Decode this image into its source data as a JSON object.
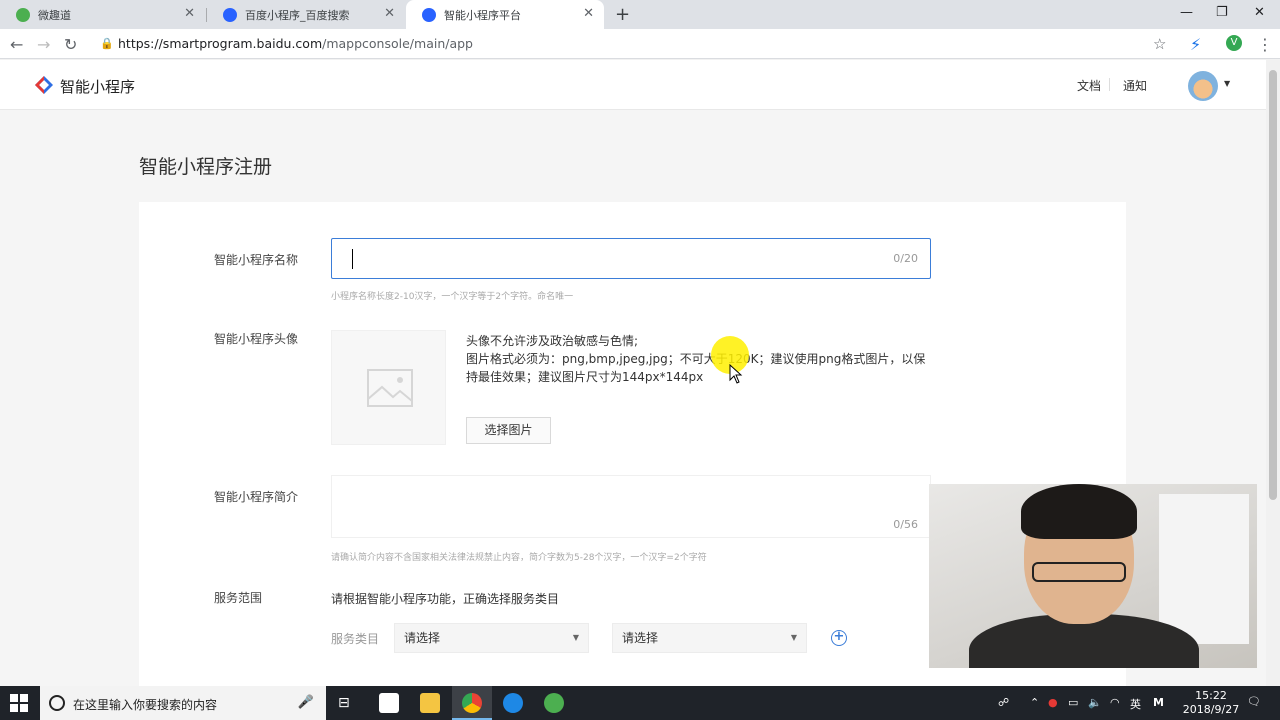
{
  "browser": {
    "tabs": [
      {
        "title": "微趣道",
        "favicon_color": "#4caf50"
      },
      {
        "title": "百度小程序_百度搜索",
        "favicon_color": "#2962ff"
      },
      {
        "title": "智能小程序平台",
        "favicon_color": "#2962ff"
      }
    ],
    "url_host": "https://smartprogram.baidu.com",
    "url_path": "/mappconsole/main/app"
  },
  "header": {
    "logo_text": "智能小程序",
    "nav": {
      "docs": "文档",
      "notice": "通知"
    }
  },
  "form": {
    "title": "智能小程序注册",
    "name": {
      "label": "智能小程序名称",
      "counter": "0/20",
      "hint": "小程序名称长度2-10汉字，一个汉字等于2个字符。命名唯一"
    },
    "avatar": {
      "label": "智能小程序头像",
      "desc_line1": "头像不允许涉及政治敏感与色情;",
      "desc_line2": "图片格式必须为：png,bmp,jpeg,jpg；不可大于120K；建议使用png格式图片，以保持最佳效果；建议图片尺寸为144px*144px",
      "button": "选择图片"
    },
    "intro": {
      "label": "智能小程序简介",
      "counter": "0/56",
      "hint": "请确认简介内容不含国家相关法律法规禁止内容，简介字数为5-28个汉字，一个汉字=2个字符"
    },
    "service": {
      "label": "服务范围",
      "desc": "请根据智能小程序功能，正确选择服务类目",
      "category_label": "服务类目",
      "select1": "请选择",
      "select2": "请选择"
    }
  },
  "taskbar": {
    "search_placeholder": "在这里输入你要搜索的内容",
    "lang": "英",
    "time": "15:22",
    "date": "2018/9/27"
  },
  "colors": {
    "accent": "#3b7dd8",
    "highlight": "#fff000"
  }
}
